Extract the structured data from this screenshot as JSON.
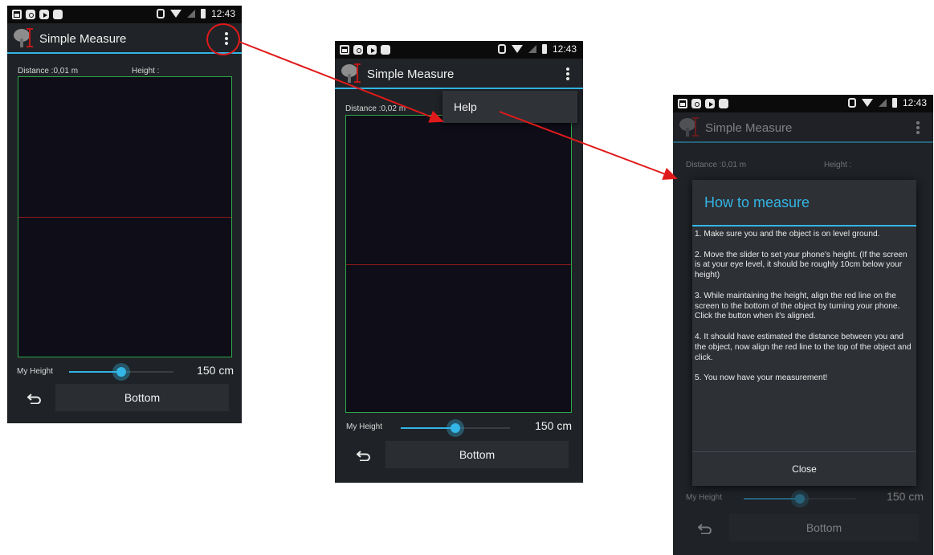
{
  "statusbar": {
    "time": "12:43"
  },
  "app": {
    "title": "Simple Measure"
  },
  "screen1": {
    "distance": "Distance :0,01 m",
    "height": "Height :",
    "my_height_label": "My Height",
    "my_height_value": "150 cm",
    "slider_fraction": 0.5,
    "bottom_button": "Bottom"
  },
  "screen2": {
    "distance": "Distance :0,02 m",
    "menu_item_help": "Help",
    "my_height_label": "My Height",
    "my_height_value": "150 cm",
    "slider_fraction": 0.5,
    "bottom_button": "Bottom"
  },
  "screen3": {
    "distance": "Distance :0,01 m",
    "height": "Height :",
    "my_height_label": "My Height",
    "my_height_value": "150 cm",
    "bottom_button": "Bottom",
    "dialog": {
      "title": "How to measure",
      "steps": [
        "1. Make sure you and the object is on level ground.",
        "2. Move the slider to set your phone's height. (If the screen is at your eye level, it should be roughly 10cm below your height)",
        "3. While maintaining the height, align the red line on the screen to the bottom of the object by turning your phone. Click the button when it's aligned.",
        "4. It should have estimated the distance between you and the object, now align the red line to the top of the object and click.",
        "5. You now have your measurement!"
      ],
      "close_button": "Close"
    }
  },
  "colors": {
    "accent": "#33b5e5",
    "frame": "#2ea84a",
    "annotation": "#e01a1a",
    "redline": "#8b1a1a"
  }
}
